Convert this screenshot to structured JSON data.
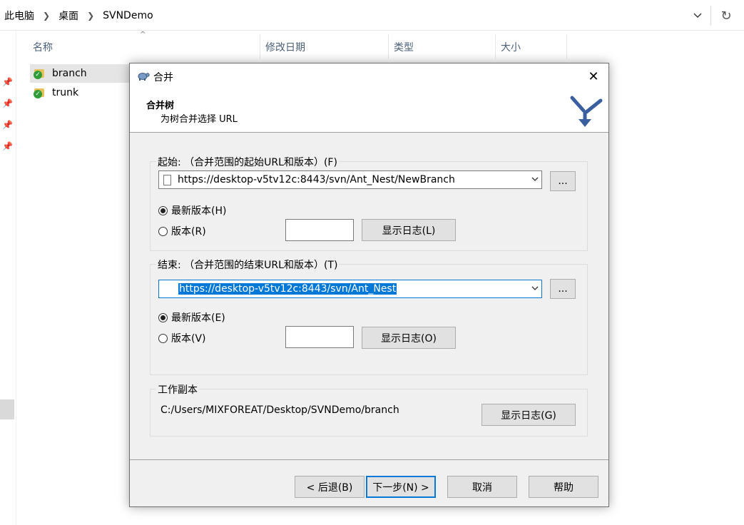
{
  "explorer": {
    "breadcrumbs": [
      "此电脑",
      "桌面",
      "SVNDemo"
    ],
    "columns": [
      "名称",
      "修改日期",
      "类型",
      "大小"
    ],
    "files": [
      {
        "name": "branch",
        "selected": true
      },
      {
        "name": "trunk",
        "selected": false
      }
    ],
    "icons": [
      "chevron-right-icon",
      "chevron-down-icon",
      "refresh-icon",
      "pin-icon",
      "svn-folder-icon"
    ]
  },
  "dialog": {
    "title": "合并",
    "header": {
      "title": "合并树",
      "subtitle": "为树合并选择 URL"
    },
    "from": {
      "label": "起始: （合并范围的起始URL和版本）(F)",
      "url": "https://desktop-v5tv12c:8443/svn/Ant_Nest/NewBranch",
      "browse_label": "...",
      "head_label": "最新版本(H)",
      "head_selected": true,
      "revision_label": "版本(R)",
      "revision_value": "",
      "log_button": "显示日志(L)"
    },
    "to": {
      "label": "结束: （合并范围的结束URL和版本）(T)",
      "url": "https://desktop-v5tv12c:8443/svn/Ant_Nest",
      "browse_label": "...",
      "head_label": "最新版本(E)",
      "head_selected": true,
      "revision_label": "版本(V)",
      "revision_value": "",
      "log_button": "显示日志(O)"
    },
    "working_copy": {
      "label": "工作副本",
      "path": "C:/Users/MIXFOREAT/Desktop/SVNDemo/branch",
      "log_button": "显示日志(G)"
    },
    "buttons": {
      "back": "< 后退(B)",
      "next": "下一步(N) >",
      "cancel": "取消",
      "help": "帮助"
    }
  },
  "colors": {
    "accent": "#0078d7",
    "dialog_bg": "#f0f0f0",
    "folder": "#e8c15a",
    "svn_ok": "#2f9c37"
  }
}
